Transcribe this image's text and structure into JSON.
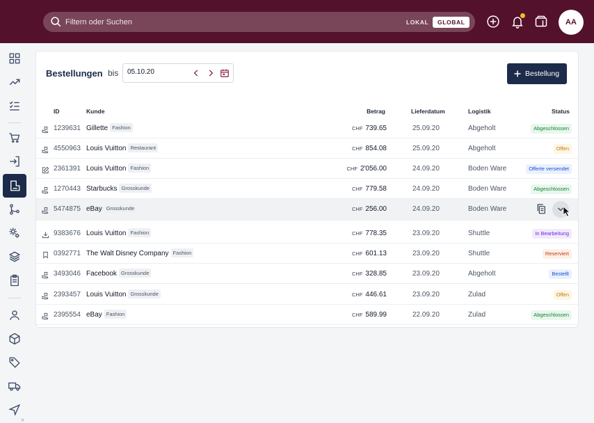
{
  "search": {
    "placeholder": "Filtern oder Suchen",
    "scope_local": "LOKAL",
    "scope_global": "GLOBAL"
  },
  "header": {
    "avatar_initials": "AA",
    "notification_dot": true
  },
  "page": {
    "title": "Bestellungen",
    "bis_label": "bis",
    "date_value": "05.10.20",
    "add_button": "Bestellung"
  },
  "columns": {
    "id": "ID",
    "customer": "Kunde",
    "amount": "Betrag",
    "delivery": "Lieferdatum",
    "logistics": "Logistik",
    "status": "Status"
  },
  "orders": [
    {
      "icon": "handover",
      "id": "1239631",
      "customer": "Gillette",
      "tag": "Fashion",
      "currency": "CHF",
      "amount": "739.65",
      "date": "25.09.20",
      "logistics": "Abgeholt",
      "status": "Abgeschlossen",
      "status_color": "green"
    },
    {
      "icon": "handover",
      "id": "4550963",
      "customer": "Louis Vuitton",
      "tag": "Restaurant",
      "currency": "CHF",
      "amount": "854.08",
      "date": "25.09.20",
      "logistics": "Abgeholt",
      "status": "Offen",
      "status_color": "yellow"
    },
    {
      "icon": "edit",
      "id": "2361391",
      "customer": "Louis Vuitton",
      "tag": "Fashion",
      "currency": "CHF",
      "amount": "2'056.00",
      "date": "24.09.20",
      "logistics": "Boden Ware",
      "status": "Offerte versendet",
      "status_color": "blue"
    },
    {
      "icon": "handover",
      "id": "1270443",
      "customer": "Starbucks",
      "tag": "Grosskunde",
      "currency": "CHF",
      "amount": "779.58",
      "date": "24.09.20",
      "logistics": "Boden Ware",
      "status": "Abgeschlossen",
      "status_color": "green"
    },
    {
      "icon": "handover",
      "id": "5474875",
      "customer": "eBay",
      "tag": "Grosskunde",
      "currency": "CHF",
      "amount": "256.00",
      "date": "24.09.20",
      "logistics": "Boden Ware",
      "status": "",
      "status_color": "none",
      "hover": true
    },
    {
      "icon": "download",
      "id": "9383676",
      "customer": "Louis Vuitton",
      "tag": "Fashion",
      "currency": "CHF",
      "amount": "778.35",
      "date": "23.09.20",
      "logistics": "Shuttle",
      "status": "In Bearbeitung",
      "status_color": "purple"
    },
    {
      "icon": "bookmark",
      "id": "0392771",
      "customer": "The Walt Disney Company",
      "tag": "Fashion",
      "currency": "CHF",
      "amount": "601.13",
      "date": "23.09.20",
      "logistics": "Shuttle",
      "status": "Reserviert",
      "status_color": "orange"
    },
    {
      "icon": "handover",
      "id": "3493046",
      "customer": "Facebook",
      "tag": "Grosskunde",
      "currency": "CHF",
      "amount": "328.85",
      "date": "23.09.20",
      "logistics": "Abgeholt",
      "status": "Bestellt",
      "status_color": "blue"
    },
    {
      "icon": "handover",
      "id": "2393457",
      "customer": "Louis Vuitton",
      "tag": "Grosskunde",
      "currency": "CHF",
      "amount": "446.61",
      "date": "23.09.20",
      "logistics": "Zulad",
      "status": "Offen",
      "status_color": "yellow"
    },
    {
      "icon": "handover",
      "id": "2395554",
      "customer": "eBay",
      "tag": "Fashion",
      "currency": "CHF",
      "amount": "589.99",
      "date": "22.09.20",
      "logistics": "Zulad",
      "status": "Abgeschlossen",
      "status_color": "green"
    }
  ],
  "sidebar": {
    "items": [
      {
        "icon": "grid-icon"
      },
      {
        "icon": "trending-icon"
      },
      {
        "icon": "checklist-icon"
      },
      {
        "icon": "cart-icon"
      },
      {
        "icon": "login-icon"
      },
      {
        "icon": "orders-icon",
        "active": true
      },
      {
        "icon": "flow-icon"
      },
      {
        "icon": "cogs-icon"
      },
      {
        "icon": "layers-icon"
      },
      {
        "icon": "clipboard-icon"
      },
      {
        "icon": "user-icon"
      },
      {
        "icon": "box-icon"
      },
      {
        "icon": "tag-icon"
      },
      {
        "icon": "truck-icon"
      },
      {
        "icon": "navigation-icon"
      }
    ],
    "expand_label": "»"
  },
  "colors": {
    "topbar": "#54112b",
    "primary": "#1c2b4a",
    "accent_dot": "#f5b92b"
  }
}
